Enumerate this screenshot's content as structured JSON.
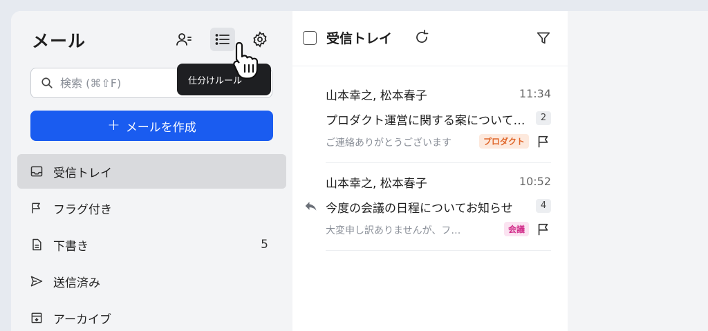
{
  "sidebar": {
    "title": "メール",
    "search_placeholder": "検索 (⌘⇧F)",
    "tooltip": "仕分けルール",
    "compose_label": "メールを作成",
    "items": [
      {
        "label": "受信トレイ",
        "count": "",
        "icon": "inbox-icon",
        "active": true
      },
      {
        "label": "フラグ付き",
        "count": "",
        "icon": "flag-icon",
        "active": false
      },
      {
        "label": "下書き",
        "count": "5",
        "icon": "draft-icon",
        "active": false
      },
      {
        "label": "送信済み",
        "count": "",
        "icon": "send-icon",
        "active": false
      },
      {
        "label": "アーカイブ",
        "count": "",
        "icon": "archive-icon",
        "active": false
      }
    ]
  },
  "list": {
    "title": "受信トレイ",
    "messages": [
      {
        "from": "山本幸之, 松本春子",
        "time": "11:34",
        "subject": "プロダクト運営に関する案についてのご相談",
        "thread_count": "2",
        "preview": "ご連絡ありがとうございます",
        "tag": "プロダクト",
        "tag_color": "#fde9dd",
        "tag_text_color": "#e0672b"
      },
      {
        "from": "山本幸之, 松本春子",
        "time": "10:52",
        "subject": "今度の会議の日程についてお知らせ",
        "thread_count": "4",
        "preview": "大変申し訳ありませんが、ファイル",
        "tag": "会議",
        "tag_color": "#fbe3f1",
        "tag_text_color": "#d12d8a",
        "replied": true
      }
    ]
  },
  "colors": {
    "accent": "#1a5cf0",
    "sidebar_bg": "#f3f4f6",
    "active_item_bg": "#d9dadd"
  }
}
